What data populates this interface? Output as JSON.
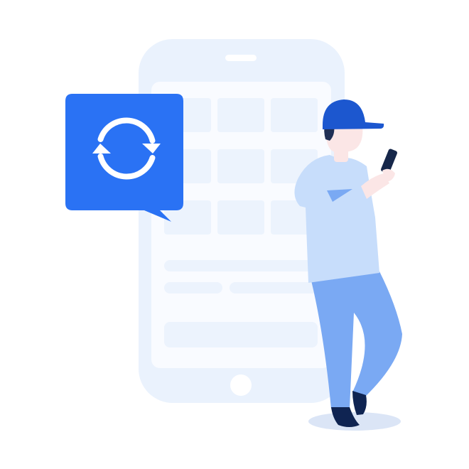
{
  "illustration": {
    "icons": {
      "sync_badge": "sync-icon",
      "phone": "phone-outline-icon",
      "person": "person-with-phone-icon"
    },
    "colors": {
      "background": "#ffffff",
      "phone_body": "#eaf2fd",
      "phone_screen": "#f9fbff",
      "screen_tile": "#ecf3fd",
      "screen_bar": "#ecf3fd",
      "speaker_and_home": "#ffffff",
      "bubble": "#2a72f4",
      "sync_arrows": "#ffffff",
      "cap": "#1c57cf",
      "hair": "#1f2f55",
      "skin": "#fbe6e6",
      "shirt": "#c7ddfb",
      "pants": "#7aa9f3",
      "shoes": "#0f2452",
      "shadow": "#dbe5f6",
      "handheld_phone": "#16274a"
    }
  }
}
